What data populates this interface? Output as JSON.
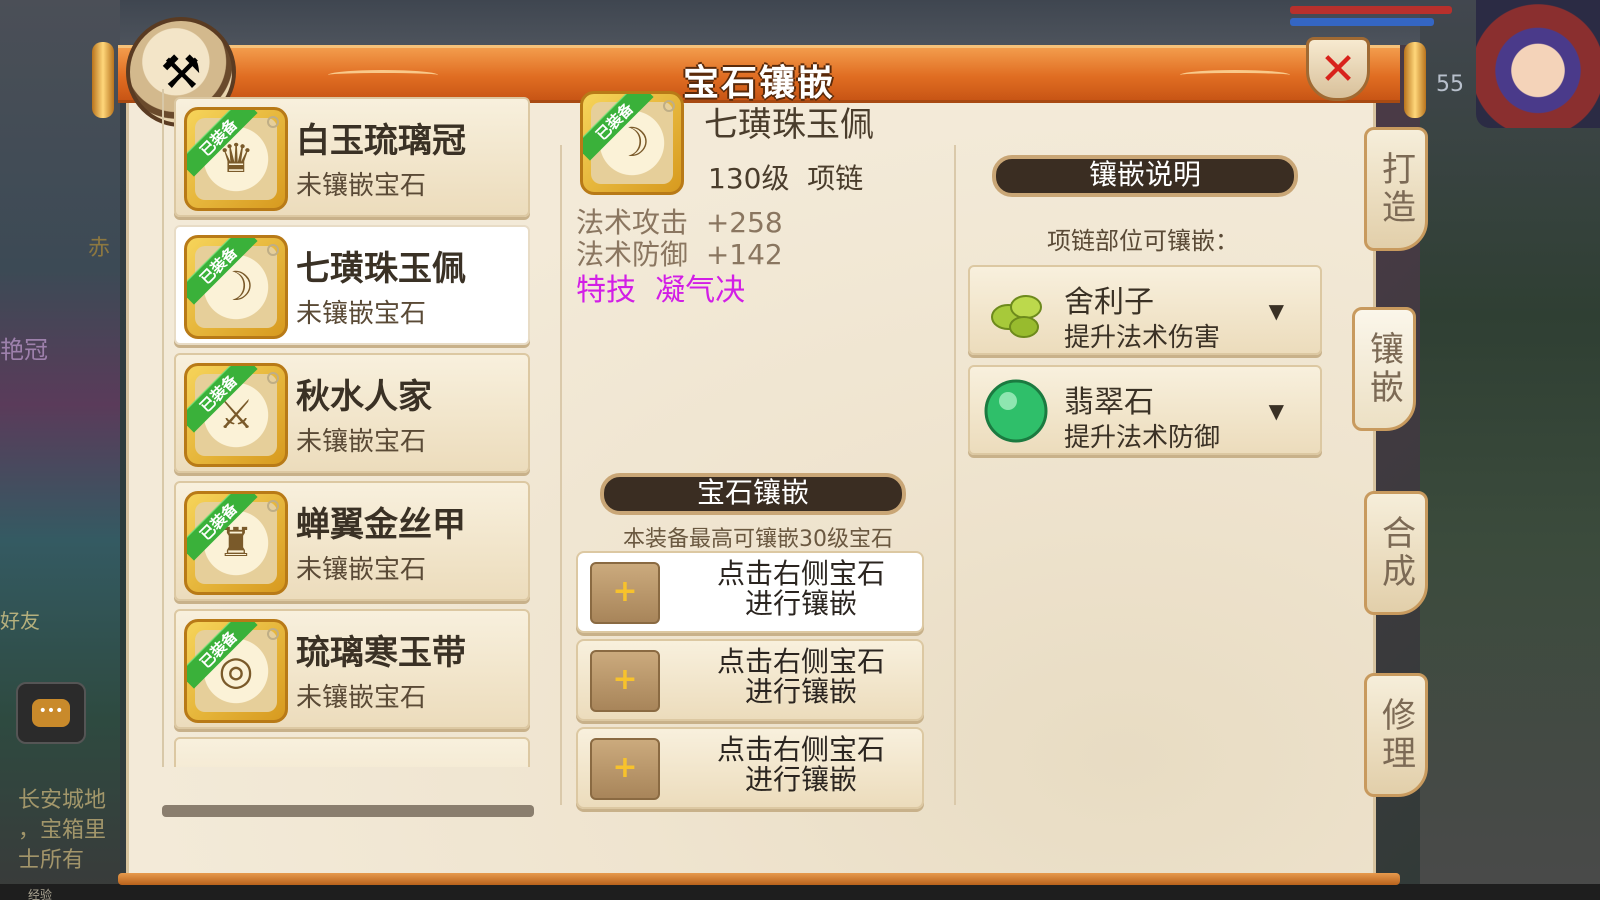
{
  "background": {
    "texts": [
      "赤",
      "艳冠",
      "好友",
      "长安城地",
      "，宝箱里",
      "士所有",
      "经验"
    ],
    "level": "55"
  },
  "window": {
    "title": "宝石镶嵌",
    "close_label": "✕"
  },
  "equipment_list": [
    {
      "name": "白玉琉璃冠",
      "status": "未镶嵌宝石",
      "badge": "已装备",
      "icon": "crown-icon"
    },
    {
      "name": "七璜珠玉佩",
      "status": "未镶嵌宝石",
      "badge": "已装备",
      "icon": "necklace-icon",
      "selected": true
    },
    {
      "name": "秋水人家",
      "status": "未镶嵌宝石",
      "badge": "已装备",
      "icon": "weapon-icon"
    },
    {
      "name": "蝉翼金丝甲",
      "status": "未镶嵌宝石",
      "badge": "已装备",
      "icon": "armor-icon"
    },
    {
      "name": "琉璃寒玉带",
      "status": "未镶嵌宝石",
      "badge": "已装备",
      "icon": "belt-icon"
    }
  ],
  "detail": {
    "badge": "已装备",
    "name": "七璜珠玉佩",
    "level": "130级",
    "slot": "项链",
    "stats": [
      {
        "label": "法术攻击",
        "value": "+258"
      },
      {
        "label": "法术防御",
        "value": "+142"
      }
    ],
    "special_label": "特技",
    "special_value": "凝气决"
  },
  "gem_section": {
    "header": "宝石镶嵌",
    "note": "本装备最高可镶嵌30级宝石",
    "slots": [
      {
        "line1": "点击右侧宝石",
        "line2": "进行镶嵌",
        "plus": "+"
      },
      {
        "line1": "点击右侧宝石",
        "line2": "进行镶嵌",
        "plus": "+"
      },
      {
        "line1": "点击右侧宝石",
        "line2": "进行镶嵌",
        "plus": "+"
      }
    ]
  },
  "description": {
    "header": "镶嵌说明",
    "subtitle": "项链部位可镶嵌：",
    "gems": [
      {
        "name": "舍利子",
        "effect": "提升法术伤害",
        "color": "#a7c93a",
        "arrow": "▼"
      },
      {
        "name": "翡翠石",
        "effect": "提升法术防御",
        "color": "#2fbf6a",
        "arrow": "▼"
      }
    ]
  },
  "side_tabs": [
    {
      "label": "打造"
    },
    {
      "label": "镶嵌",
      "active": true
    },
    {
      "label": "合成"
    },
    {
      "label": "修理"
    }
  ],
  "colors": {
    "title_bar": "#e06d22",
    "special_text": "#d21ee6",
    "equipped_ribbon": "#3ab13a",
    "close_x": "#d8221b"
  }
}
